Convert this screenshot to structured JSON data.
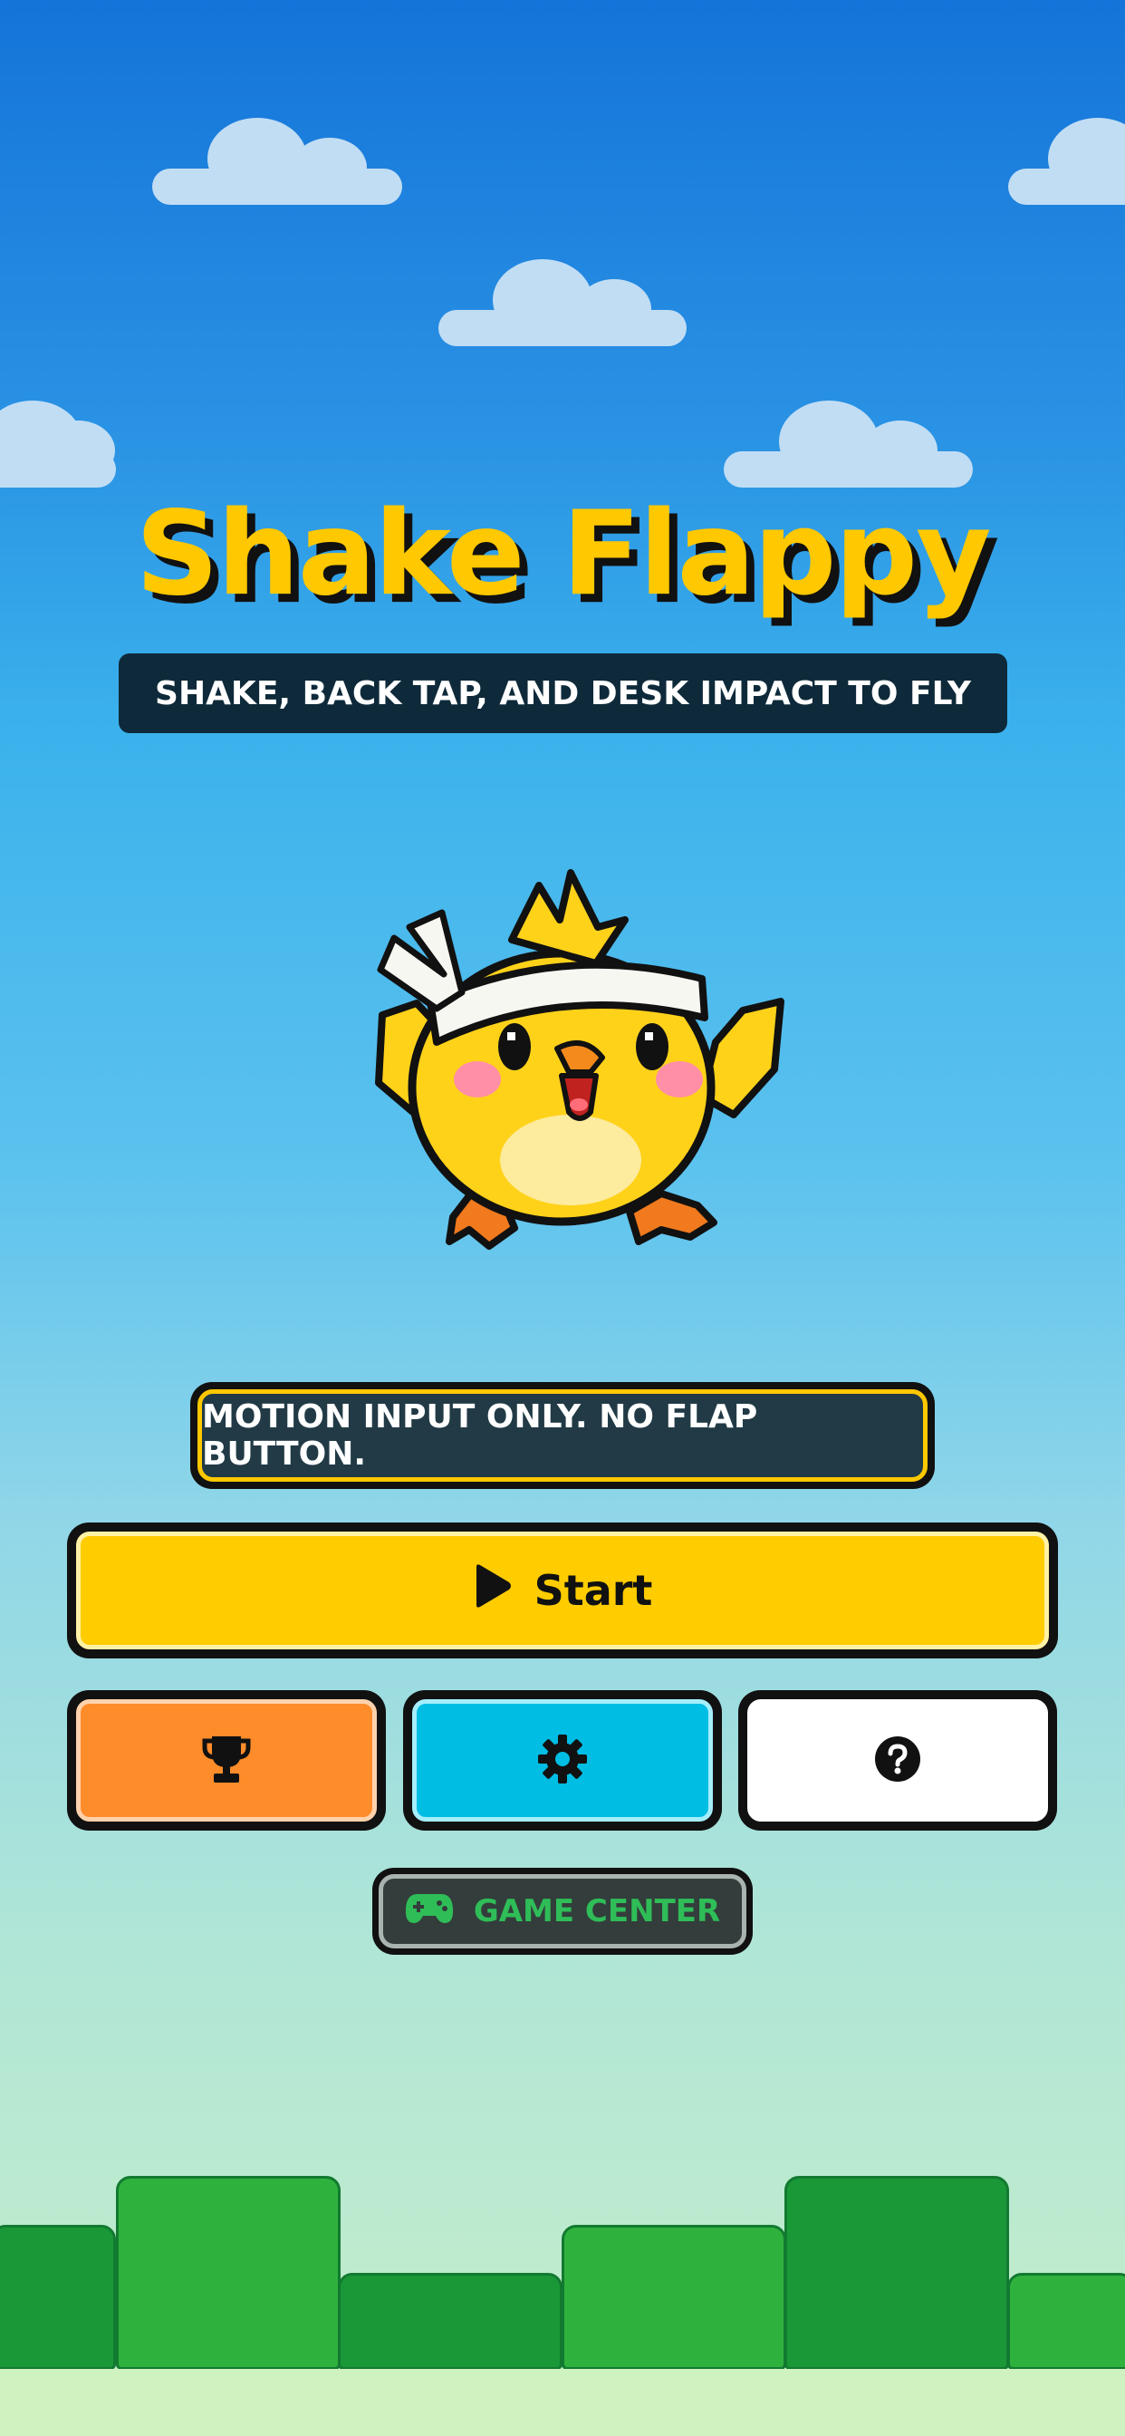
{
  "game": {
    "title": "Shake Flappy",
    "subtitle": "SHAKE, BACK TAP, AND DESK IMPACT TO FLY",
    "mascot": "pixel-chick-with-headband",
    "notice": "MOTION INPUT ONLY. NO FLAP BUTTON."
  },
  "buttons": {
    "start": {
      "label": "Start",
      "icon": "play-icon"
    },
    "leaderboard": {
      "icon": "trophy-icon"
    },
    "settings": {
      "icon": "gear-icon"
    },
    "help": {
      "icon": "question-icon"
    },
    "game_center": {
      "label": "GAME CENTER",
      "icon": "gamepad-icon"
    }
  },
  "colors": {
    "sky_top": "#1474d9",
    "sky_bottom": "#c6eeca",
    "title": "#ffc800",
    "start_button": "#ffcc00",
    "leaderboard_button": "#ff8c2a",
    "settings_button": "#00bde3",
    "help_button": "#ffffff",
    "game_center_text": "#2fbd58",
    "pipe_light": "#2fb13e",
    "pipe_dark": "#1a9838"
  }
}
